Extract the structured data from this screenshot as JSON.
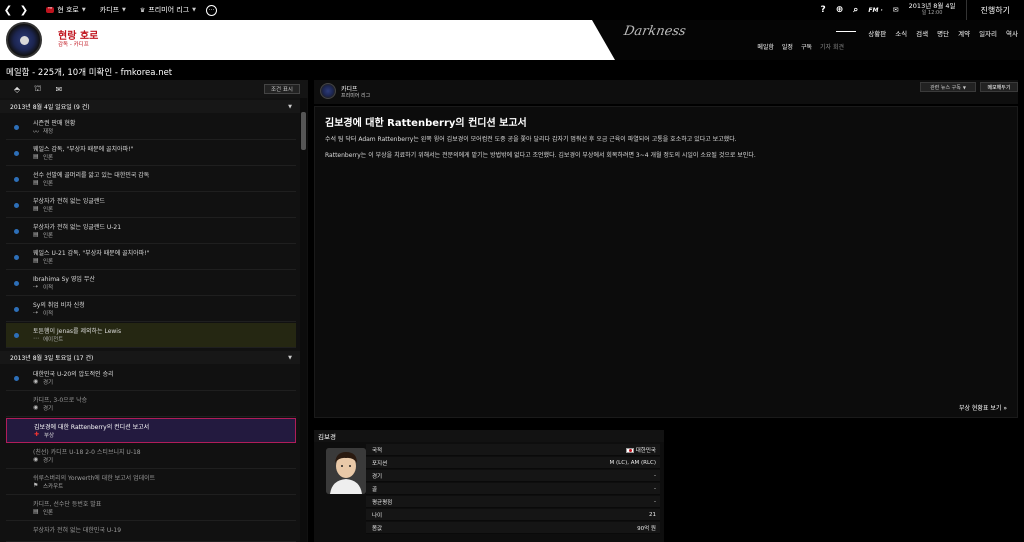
{
  "topbar": {
    "club_label": "현 호로",
    "team_label": "카디프",
    "league_label": "프리미어 리그",
    "date": "2013년 8월 4일",
    "time": "일 12:00",
    "continue_label": "진행하기"
  },
  "header": {
    "club_name": "현랑 호로",
    "club_sub": "감독 - 카디프",
    "skin_name": "Darkness",
    "main_nav": [
      "상황판",
      "소식",
      "검색",
      "명단",
      "계약",
      "일자리",
      "역사"
    ],
    "sub_nav": [
      "메일함",
      "일정",
      "구독",
      "기자 회견"
    ]
  },
  "inbox": {
    "subtitle": "메일함 - 225개, 10개 미확인 - fmkorea.net",
    "filter_label": "조건 표시",
    "days": [
      {
        "label": "2013년 8월 4일 일요일 (9 건)"
      },
      {
        "label": "2013년 8월 3일 토요일 (17 건)"
      }
    ],
    "messages_day1": [
      {
        "title": "시즌권 판매 현황",
        "category": "재정",
        "icon": "chart-icon"
      },
      {
        "title": "웨일스 감독, \"부상자 때문에 골치아파!\"",
        "category": "인론",
        "icon": "newspaper-icon"
      },
      {
        "title": "선수 선발에 골머리를 앓고 있는 대한민국 감독",
        "category": "인론",
        "icon": "newspaper-icon"
      },
      {
        "title": "부상자가 전혀 없는 잉글랜드",
        "category": "인론",
        "icon": "newspaper-icon"
      },
      {
        "title": "부상자가 전혀 없는 잉글랜드 U-21",
        "category": "인론",
        "icon": "newspaper-icon"
      },
      {
        "title": "웨일스 U-21 감독, \"부상자 때문에 골치아파!\"",
        "category": "인론",
        "icon": "newspaper-icon"
      },
      {
        "title": "Ibrahima Sy 영입 무산",
        "category": "이적",
        "icon": "transfer-icon"
      },
      {
        "title": "Sy의 취업 비자 신청",
        "category": "이적",
        "icon": "transfer-icon"
      },
      {
        "title": "토튼햄이 Jenas를 제외하는 Lewis",
        "category": "에이전트",
        "icon": "handshake-icon"
      }
    ],
    "messages_day2": [
      {
        "title": "대한민국 U-20의 압도적인 승리",
        "category": "경기",
        "icon": "ball-icon"
      },
      {
        "title": "카디프, 3-0으로 낙승",
        "category": "경기",
        "icon": "ball-icon"
      },
      {
        "title": "김보경에 대한 Rattenberry의 컨디션 보고서",
        "category": "부상",
        "icon": "medical-cross-icon"
      },
      {
        "title": "(친선) 카디프 U-18 2-0 스티브니지 U-18",
        "category": "경기",
        "icon": "ball-icon"
      },
      {
        "title": "쉬루스버리의 Yorwerth에 대한 보고서 업데이트",
        "category": "스카우트",
        "icon": "scout-icon"
      },
      {
        "title": "카디프, 선수단 등번호 발표",
        "category": "인론",
        "icon": "newspaper-icon"
      },
      {
        "title": "부상자가 전혀 없는 대한민국 U-19",
        "category": "",
        "icon": "newspaper-icon"
      }
    ]
  },
  "article": {
    "sender": "카디프",
    "competition": "프리미어 리그",
    "news_button": "관련 뉴스 구독",
    "memo_button": "메모해두기",
    "title": "김보경에 대한 Rattenberry의 컨디션 보고서",
    "paragraph1": "수석 팀 닥터 Adam Rattenberry는 왼쪽 윙어 김보경이 모어컴전 도중 공을 쫓아 달리다 갑자기 멈춰선 후 오금 근육이 파열되어 고통을 호소하고 있다고 보고했다.",
    "paragraph2": "Rattenberry는 이 부상을 치료하기 위해서는 전문의에게 맡기는 방법밖에 없다고 조언했다. 김보경이 부상에서 회복하려면 3~4 개월 정도의 시일이 소요될 것으로 보인다.",
    "injury_link": "부상 현황표 보기 »"
  },
  "player": {
    "name": "김보경",
    "rows": [
      {
        "key": "국적",
        "value": "대한민국"
      },
      {
        "key": "포지션",
        "value": "M (LC), AM (RLC)"
      },
      {
        "key": "경기",
        "value": "-"
      },
      {
        "key": "골",
        "value": "-"
      },
      {
        "key": "평균평점",
        "value": "-"
      },
      {
        "key": "나이",
        "value": "21"
      },
      {
        "key": "몸값",
        "value": "90억 원"
      }
    ]
  },
  "colors": {
    "accent": "#c0141e",
    "unread_dot": "#2d6fb8",
    "selected_border": "#b01d5a"
  }
}
